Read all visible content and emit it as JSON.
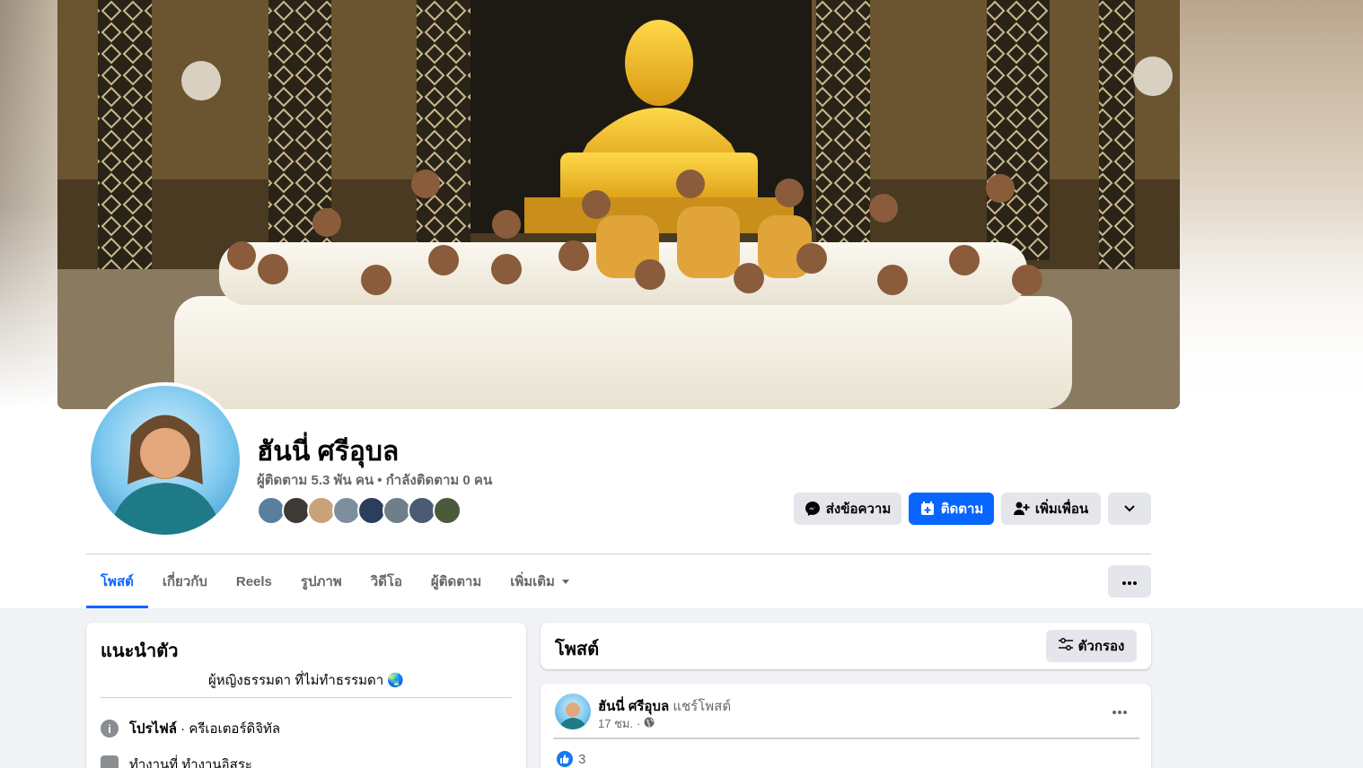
{
  "profile": {
    "name": "ฮันนี่ ศรีอุบล",
    "stats": "ผู้ติดตาม 5.3 พัน คน • กำลังติดตาม 0 คน"
  },
  "actions": {
    "message_label": "ส่งข้อความ",
    "follow_label": "ติดตาม",
    "add_friend_label": "เพิ่มเพื่อน"
  },
  "tabs": [
    {
      "label": "โพสต์"
    },
    {
      "label": "เกี่ยวกับ"
    },
    {
      "label": "Reels"
    },
    {
      "label": "รูปภาพ"
    },
    {
      "label": "วิดีโอ"
    },
    {
      "label": "ผู้ติดตาม"
    },
    {
      "label": "เพิ่มเติม"
    }
  ],
  "intro": {
    "title": "แนะนำตัว",
    "bio": "ผู้หญิงธรรมดา ที่ไม่ทำธรรมดา",
    "bio_emoji": "🌏",
    "profile_label": "โปรไฟล์",
    "profile_value": "· ครีเอเตอร์ดิจิทัล",
    "work_text": "ทำงานที่ ทำงานอิสระ"
  },
  "posts": {
    "title": "โพสต์",
    "filter_label": "ตัวกรอง"
  },
  "post": {
    "author": "ฮันนี่ ศรีอุบล",
    "action": "แชร์โพสต์",
    "time": "17 ชม.",
    "separator": "·",
    "like_count": "3"
  },
  "colors": {
    "accent": "#0866ff",
    "grey_button": "#e4e6eb",
    "page_bg": "#f0f2f5",
    "secondary_text": "#65676b"
  }
}
